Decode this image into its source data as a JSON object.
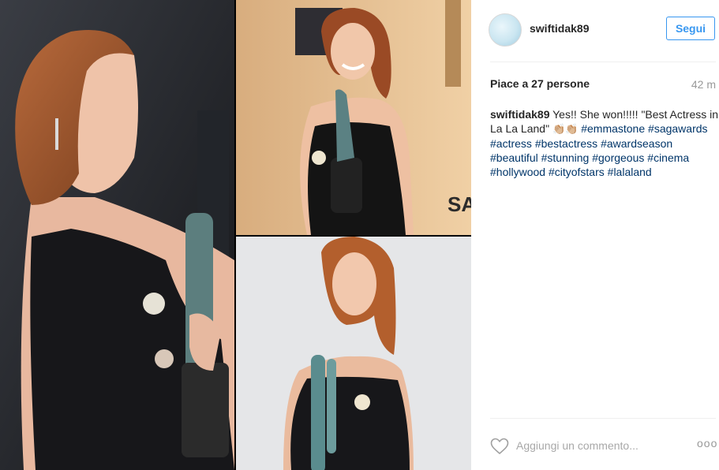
{
  "post": {
    "username": "swiftidak89",
    "avatar_text": "",
    "follow_label": "Segui",
    "likes_text": "Piace a 27 persone",
    "time_ago": "42 m",
    "caption": {
      "user": "swiftidak89",
      "text_before": "Yes!! She won!!!!! \"Best Actress in La La Land\"",
      "emoji": "👏🏼👏🏼",
      "hashtags": [
        "#emmastone",
        "#sagawards",
        "#actress",
        "#bestactress",
        "#awardseason",
        "#beautiful",
        "#stunning",
        "#gorgeous",
        "#cinema",
        "#hollywood",
        "#cityofstars",
        "#lalaland"
      ]
    },
    "comment_placeholder": "Aggiungi un commento...",
    "more_label": "ooo",
    "icons": {
      "like": "heart-icon",
      "more": "more-options-icon"
    },
    "photos": [
      {
        "name": "photo-left",
        "backdrop": "dark"
      },
      {
        "name": "photo-top-right",
        "backdrop": "gold"
      },
      {
        "name": "photo-bottom-right",
        "backdrop": "grey"
      }
    ],
    "backdrop_text": "SA"
  }
}
